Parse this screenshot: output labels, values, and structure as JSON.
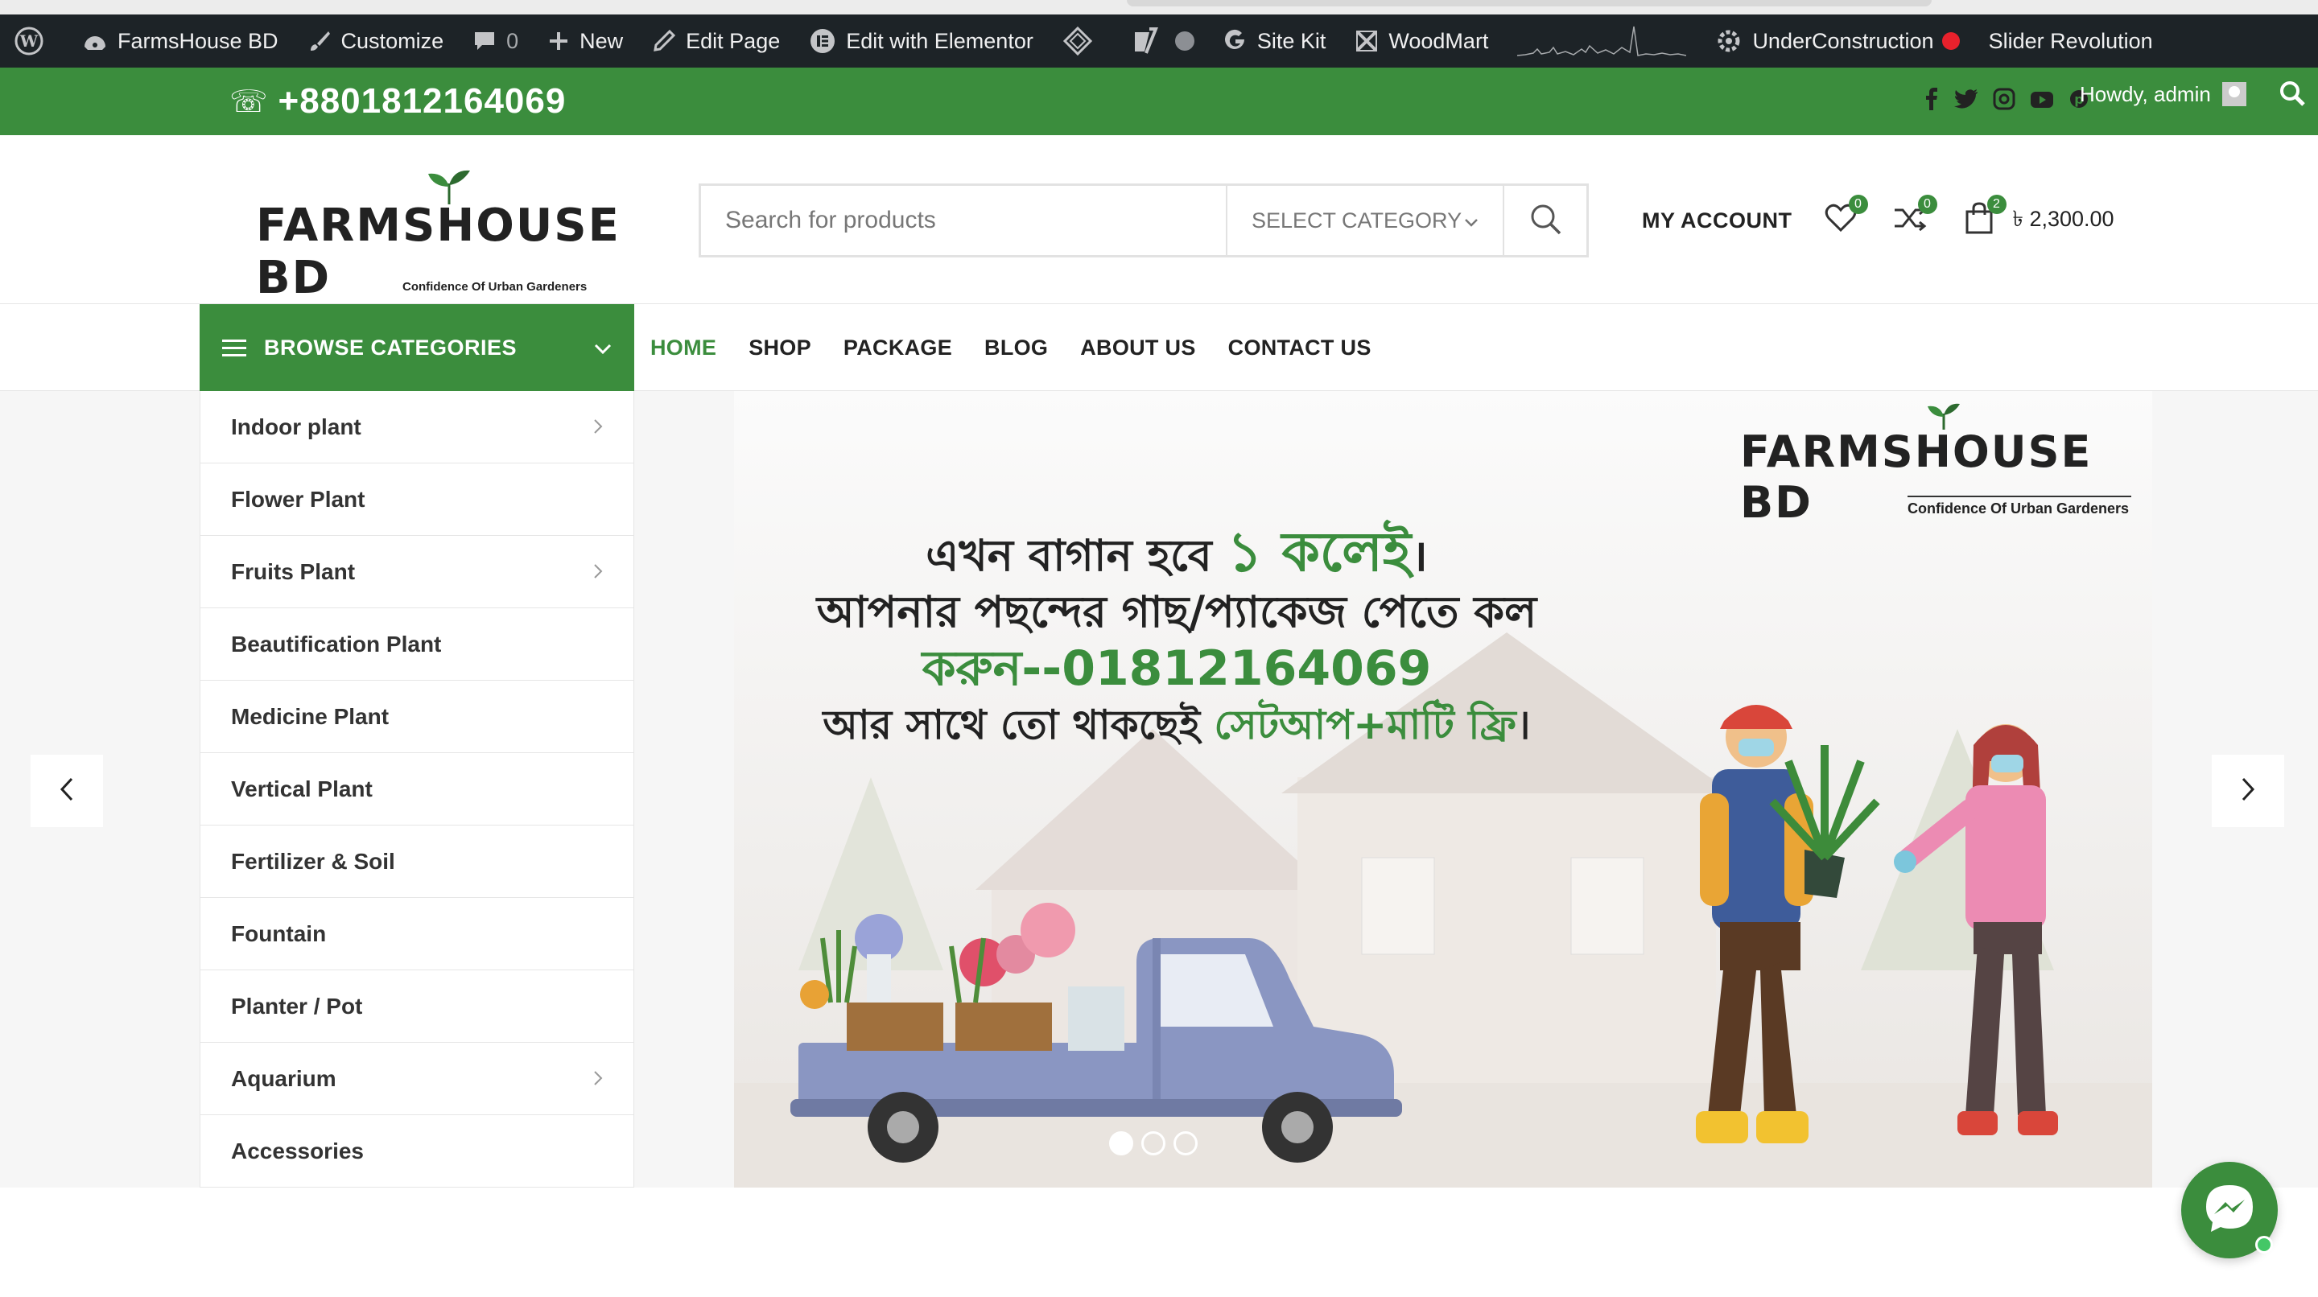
{
  "admin_bar": {
    "site_name": "FarmsHouse BD",
    "customize": "Customize",
    "comments_count": "0",
    "new": "New",
    "edit_page": "Edit Page",
    "elementor": "Edit with Elementor",
    "site_kit": "Site Kit",
    "woodmart": "WoodMart",
    "under_construction": "UnderConstruction",
    "slider_revolution": "Slider Revolution",
    "howdy": "Howdy, admin"
  },
  "topbar": {
    "phone": "+8801812164069",
    "phone_icon": "☏",
    "bg_color": "#3b8d3d"
  },
  "header": {
    "logo_text": "FARMSHOUSE BD",
    "logo_tagline": "Confidence Of Urban Gardeners",
    "search_placeholder": "Search for products",
    "select_category": "SELECT CATEGORY",
    "my_account": "MY ACCOUNT",
    "wishlist_count": "0",
    "compare_count": "0",
    "cart_count": "2",
    "cart_total": "৳ 2,300.00"
  },
  "nav": {
    "browse_label": "BROWSE CATEGORIES",
    "items": [
      {
        "label": "HOME"
      },
      {
        "label": "SHOP"
      },
      {
        "label": "PACKAGE"
      },
      {
        "label": "BLOG"
      },
      {
        "label": "ABOUT US"
      },
      {
        "label": "CONTACT US"
      }
    ]
  },
  "categories": [
    {
      "label": "Indoor plant",
      "has_sub": true
    },
    {
      "label": "Flower Plant",
      "has_sub": false
    },
    {
      "label": "Fruits Plant",
      "has_sub": true
    },
    {
      "label": "Beautification Plant",
      "has_sub": false
    },
    {
      "label": "Medicine Plant",
      "has_sub": false
    },
    {
      "label": "Vertical Plant",
      "has_sub": false
    },
    {
      "label": "Fertilizer & Soil",
      "has_sub": false
    },
    {
      "label": "Fountain",
      "has_sub": false
    },
    {
      "label": "Planter / Pot",
      "has_sub": false
    },
    {
      "label": "Aquarium",
      "has_sub": true
    },
    {
      "label": "Accessories",
      "has_sub": false
    }
  ],
  "slider": {
    "logo_text": "FARMSHOUSE BD",
    "logo_tagline": "Confidence Of Urban Gardeners",
    "line1_a": "এখন বাগান হবে ",
    "line1_b": "১ কলেই",
    "line1_c": "।",
    "line2": "আপনার পছন্দের গাছ/প্যাকেজ পেতে কল",
    "line3": "করুন--01812164069",
    "line4_a": "আর সাথে তো থাকছেই ",
    "line4_b": "সেটআপ+মাটি ফ্রি",
    "line4_c": "।",
    "dots": 3,
    "active_dot": 1
  },
  "colors": {
    "accent": "#3b8d3d",
    "admin_bg": "#1d2327"
  }
}
